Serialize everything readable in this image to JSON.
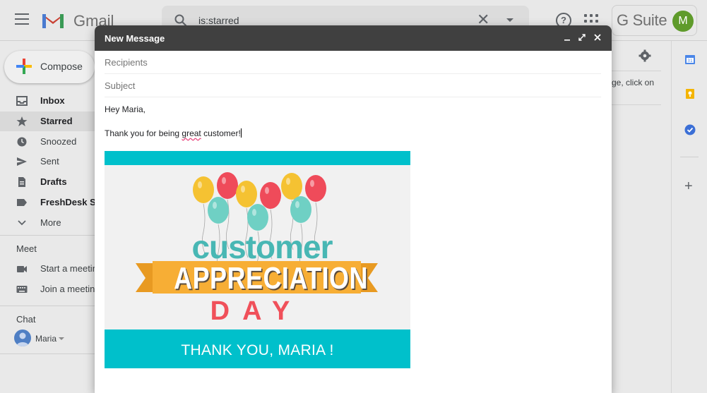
{
  "header": {
    "app_name": "Gmail",
    "search_value": "is:starred",
    "brand_label": "G Suite",
    "account_initial": "M"
  },
  "sidebar": {
    "compose_label": "Compose",
    "items": [
      {
        "label": "Inbox",
        "icon": "inbox-icon",
        "bold": true
      },
      {
        "label": "Starred",
        "icon": "star-icon",
        "bold": true,
        "active": true
      },
      {
        "label": "Snoozed",
        "icon": "clock-icon"
      },
      {
        "label": "Sent",
        "icon": "send-icon"
      },
      {
        "label": "Drafts",
        "icon": "draft-icon",
        "bold": true
      },
      {
        "label": "FreshDesk Su",
        "icon": "label-icon",
        "bold": true
      },
      {
        "label": "More",
        "icon": "chevron-down-icon"
      }
    ],
    "meet": {
      "heading": "Meet",
      "start": "Start a meetin",
      "join": "Join a meetin"
    },
    "chat": {
      "heading": "Chat",
      "user": "Maria"
    }
  },
  "right_pane": {
    "hint": "ge, click on"
  },
  "compose": {
    "title": "New Message",
    "recipients_placeholder": "Recipients",
    "subject_placeholder": "Subject",
    "greeting": "Hey Maria,",
    "message_before": "Thank you for being ",
    "message_misspelled": "great",
    "message_after": " customer!",
    "card": {
      "line1": "customer",
      "line2": "APPRECIATION",
      "line3": "DAY",
      "footer": "THANK YOU,  MARIA !"
    }
  },
  "colors": {
    "card_teal": "#00c0cb",
    "ribbon_orange": "#f7ae35",
    "day_red": "#f0505a",
    "customer_teal": "#48b7b4",
    "compose_header": "#404040"
  }
}
